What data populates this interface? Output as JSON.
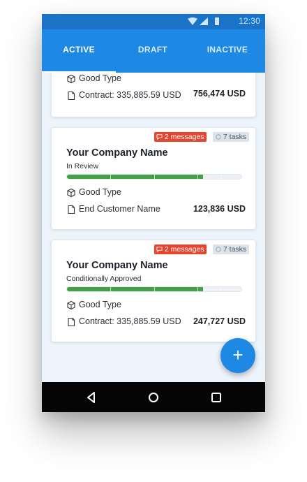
{
  "status_bar": {
    "time": "12:30"
  },
  "tabs": [
    {
      "label": "ACTIVE",
      "selected": true
    },
    {
      "label": "DRAFT",
      "selected": false
    },
    {
      "label": "INACTIVE",
      "selected": false
    }
  ],
  "cards": [
    {
      "type_label": "Good Type",
      "doc_label": "Contract: 335,885.59 USD",
      "amount": "756,474 USD"
    },
    {
      "messages_badge": "2 messages",
      "tasks_badge": "7 tasks",
      "company": "Your Company Name",
      "status": "In Review",
      "progress": 0.78,
      "type_label": "Good Type",
      "doc_label": "End Customer Name",
      "amount": "123,836 USD"
    },
    {
      "messages_badge": "2 messages",
      "tasks_badge": "7 tasks",
      "company": "Your Company Name",
      "status": "Conditionally Approved",
      "progress": 0.78,
      "type_label": "Good Type",
      "doc_label": "Contract: 335,885.59 USD",
      "amount": "247,727 USD"
    }
  ],
  "fab": {
    "label": "+"
  },
  "colors": {
    "primary": "#1e88e5",
    "status_bar": "#1a73c7",
    "progress": "#43a047",
    "message_badge": "#e5452f",
    "task_badge": "#dde3ea"
  },
  "icons": [
    "wifi-icon",
    "signal-icon",
    "battery-icon",
    "cube-icon",
    "document-icon",
    "message-icon",
    "task-icon",
    "back-icon",
    "home-icon",
    "recents-icon",
    "add-icon"
  ]
}
